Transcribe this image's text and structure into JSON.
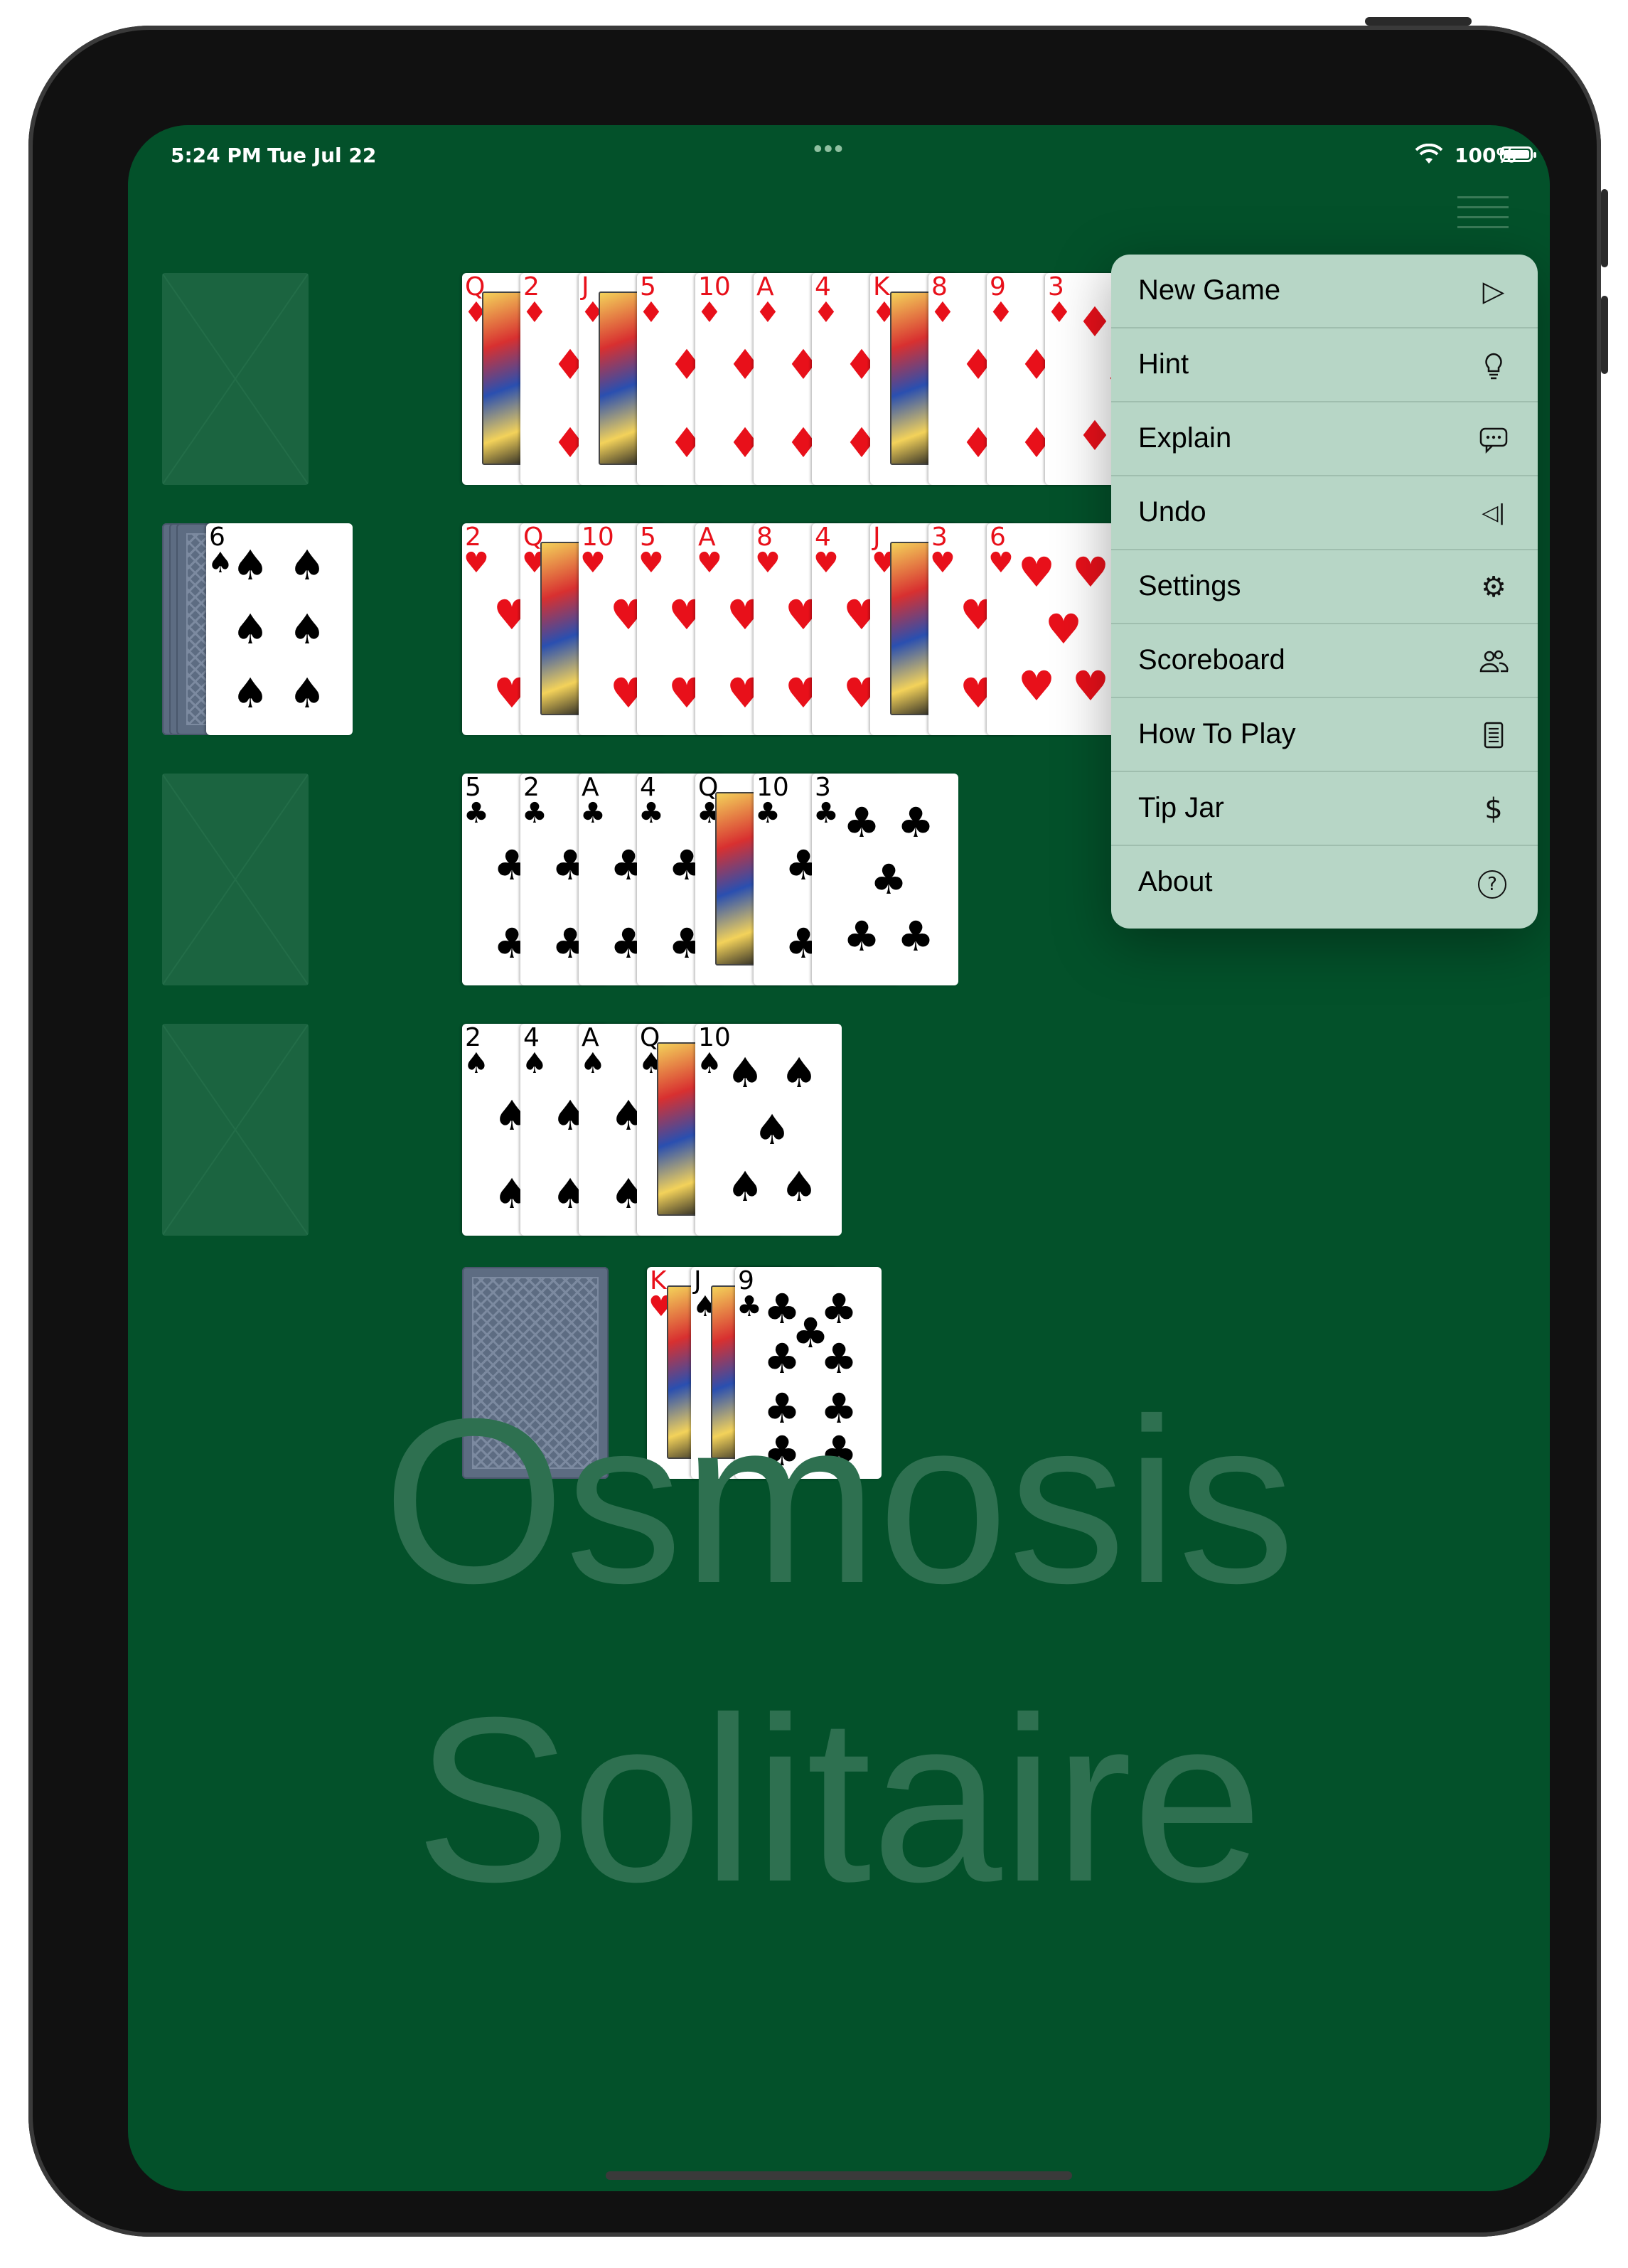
{
  "status_bar": {
    "time": "5:24 PM",
    "date": "Tue Jul 22",
    "battery": "100%",
    "dots": "•••"
  },
  "menu_button": {
    "icon": "hamburger-icon"
  },
  "popup_menu": {
    "items": [
      {
        "label": "New Game",
        "icon": "play-icon",
        "glyph": "▷"
      },
      {
        "label": "Hint",
        "icon": "lightbulb-icon",
        "glyph": ""
      },
      {
        "label": "Explain",
        "icon": "speech-bubble-icon",
        "glyph": ""
      },
      {
        "label": "Undo",
        "icon": "undo-icon",
        "glyph": "◁|"
      },
      {
        "label": "Settings",
        "icon": "gear-icon",
        "glyph": "⚙"
      },
      {
        "label": "Scoreboard",
        "icon": "people-icon",
        "glyph": ""
      },
      {
        "label": "How To Play",
        "icon": "book-icon",
        "glyph": ""
      },
      {
        "label": "Tip Jar",
        "icon": "dollar-icon",
        "glyph": "$"
      },
      {
        "label": "About",
        "icon": "question-icon",
        "glyph": "?"
      }
    ]
  },
  "tableau": {
    "rows": [
      {
        "cards": [
          {
            "rank": "Q",
            "suit": "♦"
          },
          {
            "rank": "2",
            "suit": "♦"
          },
          {
            "rank": "J",
            "suit": "♦"
          },
          {
            "rank": "5",
            "suit": "♦"
          },
          {
            "rank": "10",
            "suit": "♦"
          },
          {
            "rank": "A",
            "suit": "♦"
          },
          {
            "rank": "4",
            "suit": "♦"
          },
          {
            "rank": "K",
            "suit": "♦"
          },
          {
            "rank": "8",
            "suit": "♦"
          },
          {
            "rank": "9",
            "suit": "♦"
          },
          {
            "rank": "3",
            "suit": "♦"
          }
        ]
      },
      {
        "cards": [
          {
            "rank": "2",
            "suit": "♥"
          },
          {
            "rank": "Q",
            "suit": "♥"
          },
          {
            "rank": "10",
            "suit": "♥"
          },
          {
            "rank": "5",
            "suit": "♥"
          },
          {
            "rank": "A",
            "suit": "♥"
          },
          {
            "rank": "8",
            "suit": "♥"
          },
          {
            "rank": "4",
            "suit": "♥"
          },
          {
            "rank": "J",
            "suit": "♥"
          },
          {
            "rank": "3",
            "suit": "♥"
          },
          {
            "rank": "6",
            "suit": "♥"
          }
        ]
      },
      {
        "cards": [
          {
            "rank": "5",
            "suit": "♣"
          },
          {
            "rank": "2",
            "suit": "♣"
          },
          {
            "rank": "A",
            "suit": "♣"
          },
          {
            "rank": "4",
            "suit": "♣"
          },
          {
            "rank": "Q",
            "suit": "♣"
          },
          {
            "rank": "10",
            "suit": "♣"
          },
          {
            "rank": "3",
            "suit": "♣"
          }
        ]
      },
      {
        "cards": [
          {
            "rank": "2",
            "suit": "♠"
          },
          {
            "rank": "4",
            "suit": "♠"
          },
          {
            "rank": "A",
            "suit": "♠"
          },
          {
            "rank": "Q",
            "suit": "♠"
          },
          {
            "rank": "10",
            "suit": "♠"
          }
        ]
      }
    ]
  },
  "reserve": {
    "top_card": {
      "rank": "6",
      "suit": "♠"
    }
  },
  "waste": {
    "cards": [
      {
        "rank": "K",
        "suit": "♥"
      },
      {
        "rank": "J",
        "suit": "♠"
      },
      {
        "rank": "9",
        "suit": "♣"
      }
    ]
  },
  "watermark": {
    "line1": "Osmosis",
    "line2": "Solitaire"
  }
}
